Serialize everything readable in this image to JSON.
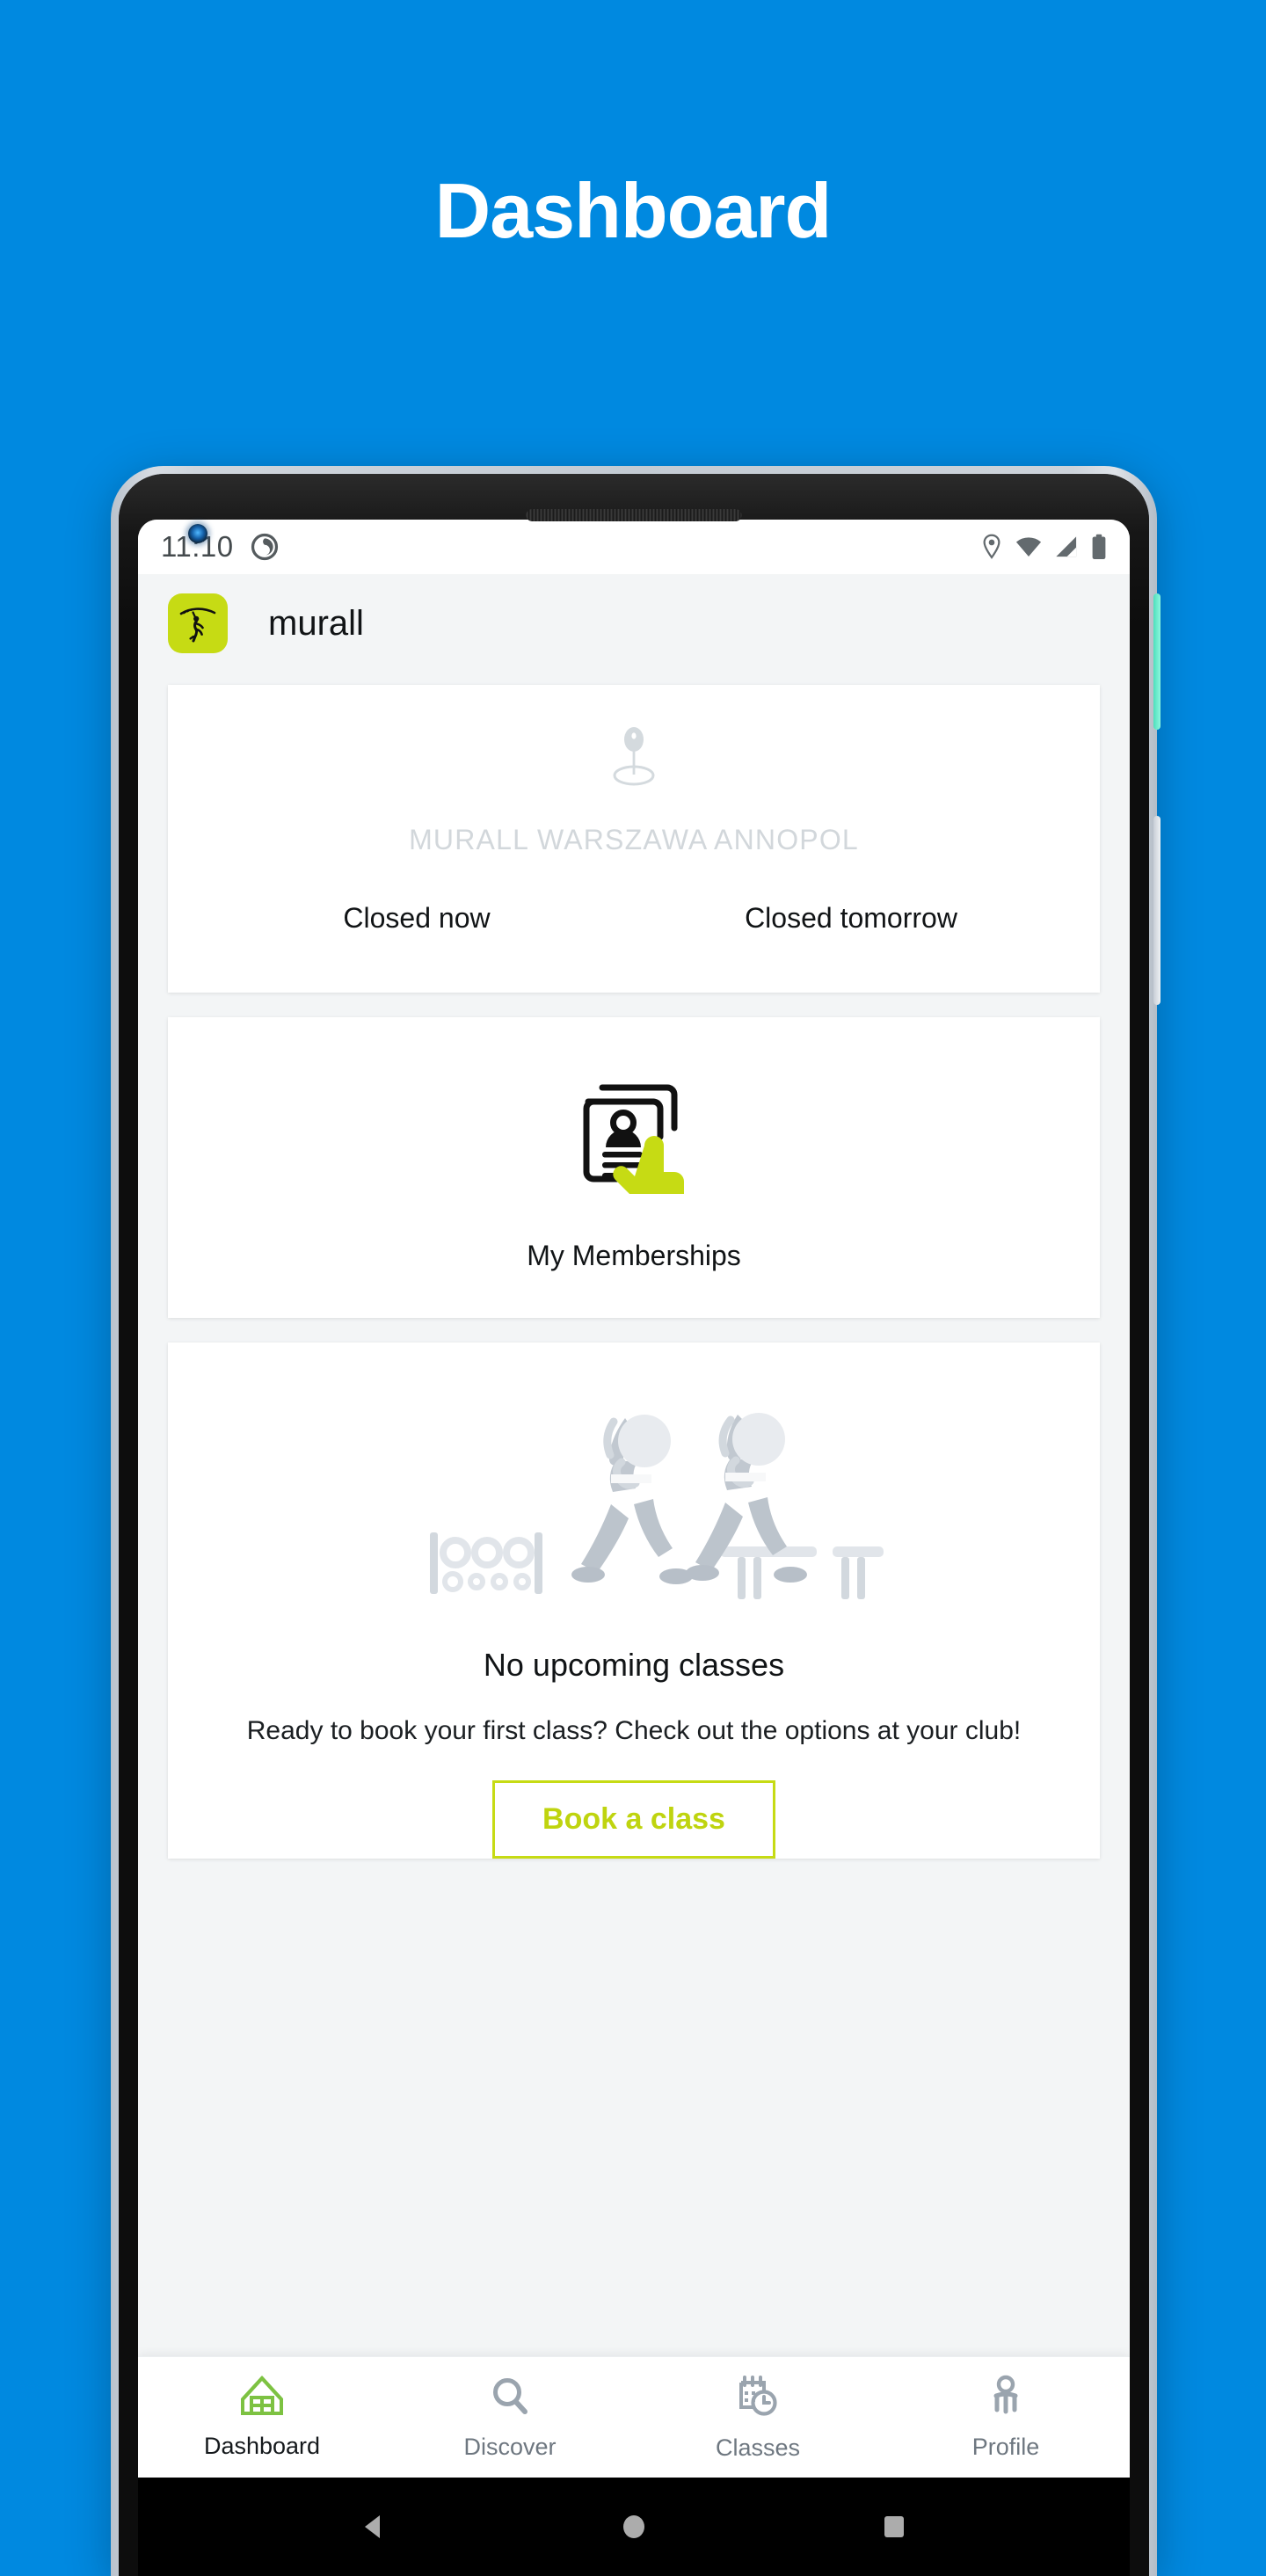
{
  "promo": {
    "title": "Dashboard",
    "background_color": "#0089E0"
  },
  "device": {
    "power_button_color": "#4de0bd",
    "volume_button_color": "#c8ced6",
    "camera": "front-camera",
    "earpiece": "earpiece-speaker"
  },
  "statusbar": {
    "time": "11:10",
    "dnd_icon": "do-not-disturb-icon",
    "icons": [
      "location-pin-icon",
      "wifi-icon",
      "cellular-signal-icon",
      "battery-icon"
    ]
  },
  "appbar": {
    "logo_icon": "murall-climber-logo",
    "logo_color": "#C6DB14",
    "brand": "murall"
  },
  "location_card": {
    "pin_icon": "map-pin-icon",
    "club_name": "MURALL WARSZAWA ANNOPOL",
    "status_now": "Closed now",
    "status_tomorrow": "Closed tomorrow"
  },
  "membership_card": {
    "icon": "membership-card-icon",
    "label": "My Memberships",
    "accent_color": "#C6DB14"
  },
  "classes_card": {
    "illustration": "people-stretching-illustration",
    "title": "No upcoming classes",
    "subtitle": "Ready to book your first class? Check out the options at your club!",
    "button_label": "Book a class",
    "button_color": "#C6DB14"
  },
  "bottomnav": {
    "items": [
      {
        "label": "Dashboard",
        "icon": "home-icon",
        "active": true
      },
      {
        "label": "Discover",
        "icon": "search-icon",
        "active": false
      },
      {
        "label": "Classes",
        "icon": "calendar-clock-icon",
        "active": false
      },
      {
        "label": "Profile",
        "icon": "person-icon",
        "active": false
      }
    ],
    "active_color": "#7DC242",
    "inactive_color": "#9AA4AE"
  },
  "androidnav": {
    "back": "back-triangle-icon",
    "home": "home-circle-icon",
    "recents": "recents-square-icon"
  }
}
